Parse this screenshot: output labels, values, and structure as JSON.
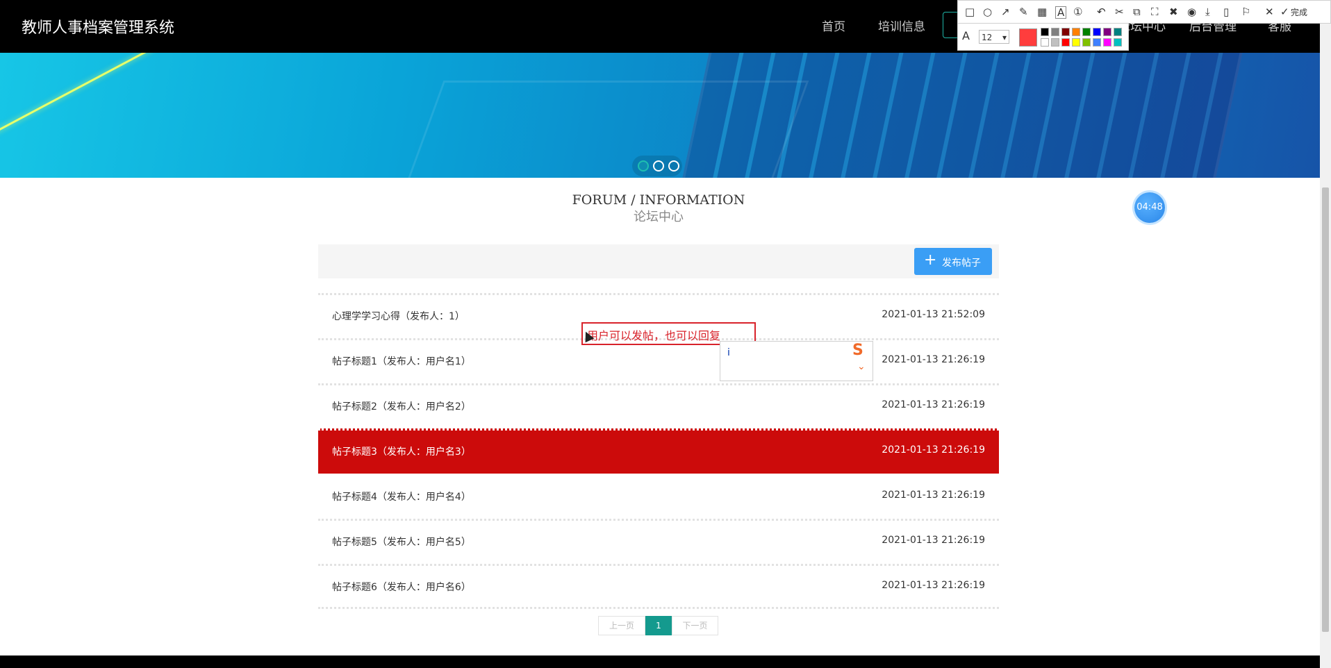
{
  "header": {
    "brand": "教师人事档案管理系统",
    "nav": [
      "首页",
      "培训信息",
      "论坛中心",
      "后台管理",
      "客服"
    ]
  },
  "banner": {
    "slide_count": 3,
    "active_slide": 1
  },
  "section": {
    "title_en": "FORUM / INFORMATION",
    "title_cn": "论坛中心"
  },
  "timer": "04:48",
  "toolbar": {
    "post_button": "发布帖子"
  },
  "posts": [
    {
      "title": "心理学学习心得（发布人：1）",
      "time": "2021-01-13 21:52:09"
    },
    {
      "title": "帖子标题1（发布人：用户名1）",
      "time": "2021-01-13 21:26:19"
    },
    {
      "title": "帖子标题2（发布人：用户名2）",
      "time": "2021-01-13 21:26:19"
    },
    {
      "title": "帖子标题3（发布人：用户名3）",
      "time": "2021-01-13 21:26:19"
    },
    {
      "title": "帖子标题4（发布人：用户名4）",
      "time": "2021-01-13 21:26:19"
    },
    {
      "title": "帖子标题5（发布人：用户名5）",
      "time": "2021-01-13 21:26:19"
    },
    {
      "title": "帖子标题6（发布人：用户名6）",
      "time": "2021-01-13 21:26:19"
    }
  ],
  "highlighted_post_index": 3,
  "annotation": {
    "text": "用户可以发帖，也可以回复"
  },
  "ime": {
    "input": "i"
  },
  "pagination": {
    "prev": "上一页",
    "current": "1",
    "next": "下一页"
  },
  "screenshot_tool": {
    "done_label": "完成",
    "font_size": "12",
    "current_color": "#ff3d3d",
    "palette": [
      "#000000",
      "#808080",
      "#800000",
      "#ff8000",
      "#008000",
      "#0000ff",
      "#800080",
      "#008080",
      "#ffffff",
      "#c0c0c0",
      "#ff0000",
      "#ffff00",
      "#80c000",
      "#4080ff",
      "#ff00ff",
      "#00c0c0"
    ]
  },
  "colors": {
    "accent": "#149a8e",
    "highlight_row": "#cc0b0b",
    "post_button": "#3a9ef5",
    "annotation": "#d8222a"
  }
}
